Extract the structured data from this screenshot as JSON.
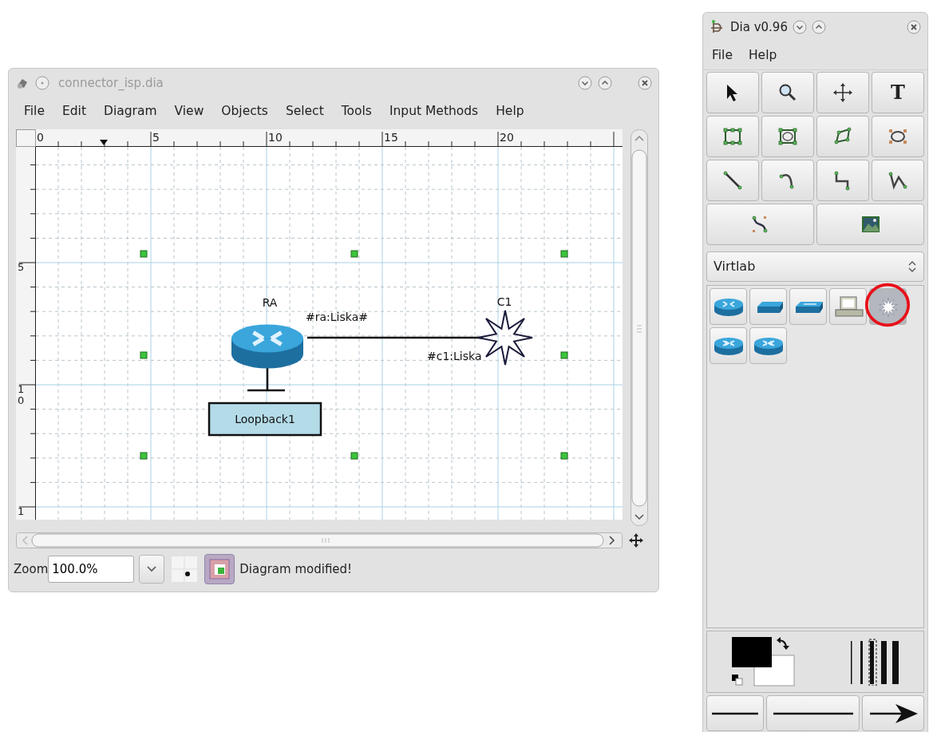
{
  "diagram_window": {
    "title": "connector_isp.dia",
    "menu": [
      "File",
      "Edit",
      "Diagram",
      "View",
      "Objects",
      "Select",
      "Tools",
      "Input Methods",
      "Help"
    ],
    "horizontal_ruler": [
      "0",
      "5",
      "10",
      "15",
      "20"
    ],
    "vertical_ruler": [
      "5",
      "10",
      "1"
    ],
    "canvas": {
      "objects": [
        {
          "kind": "router",
          "label": "RA"
        },
        {
          "kind": "burst",
          "label": "C1"
        },
        {
          "kind": "box",
          "label": "Loopback1"
        }
      ],
      "connection_labels": [
        "#ra:Liska#",
        "#c1:Liska"
      ]
    },
    "status_bar": {
      "zoom_label": "Zoom",
      "zoom_value": "100.0%",
      "snap_to_grid": {
        "on": false
      },
      "object_snapping": {
        "on": true
      },
      "message": "Diagram modified!"
    }
  },
  "toolbox": {
    "title": "Dia v0.96",
    "menu": [
      "File",
      "Help"
    ],
    "tools": [
      {
        "kind": "pointer"
      },
      {
        "kind": "magnify"
      },
      {
        "kind": "move"
      },
      {
        "kind": "text",
        "label": "T"
      },
      {
        "kind": "box"
      },
      {
        "kind": "ellipse"
      },
      {
        "kind": "polygon"
      },
      {
        "kind": "circle"
      },
      {
        "kind": "line"
      },
      {
        "kind": "arc"
      },
      {
        "kind": "zigzag"
      },
      {
        "kind": "polyline"
      },
      {
        "kind": "bezier"
      },
      {
        "kind": "image"
      }
    ],
    "sheet": "Virtlab",
    "sheet_objects": [
      {
        "kind": "router",
        "selected": false
      },
      {
        "kind": "switch",
        "selected": false
      },
      {
        "kind": "hub",
        "selected": false
      },
      {
        "kind": "computer",
        "selected": false
      },
      {
        "kind": "burst",
        "selected": true
      },
      {
        "kind": "router_in",
        "selected": false
      },
      {
        "kind": "router_out",
        "selected": false
      }
    ],
    "line_styles": [
      {
        "kind": "line"
      },
      {
        "kind": "line"
      },
      {
        "kind": "arrow"
      }
    ]
  }
}
